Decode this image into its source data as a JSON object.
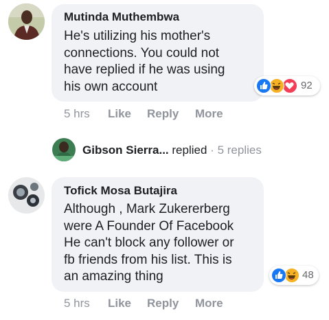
{
  "comments": [
    {
      "author": "Mutinda Muthembwa",
      "lines": [
        "He's utilizing his mother's",
        "connections. You could not",
        "have replied if he was using",
        "his own account"
      ],
      "reaction_count": "92",
      "reactions": [
        "like-icon",
        "haha-icon",
        "love-icon"
      ],
      "actions": {
        "time": "5 hrs",
        "like": "Like",
        "reply": "Reply",
        "more": "More"
      }
    },
    {
      "author": "Tofick Mosa Butajira",
      "lines": [
        "Although , Mark Zukererberg",
        "were A Founder Of Facebook",
        "He can't block any follower or",
        "fb friends from his list. This is",
        "an amazing thing"
      ],
      "reaction_count": "48",
      "reactions": [
        "like-icon",
        "haha-icon"
      ],
      "actions": {
        "time": "5 hrs",
        "like": "Like",
        "reply": "Reply",
        "more": "More"
      }
    }
  ],
  "reply_summary": {
    "name": "Gibson Sierra...",
    "verb": "replied",
    "separator": "·",
    "count": "5 replies"
  },
  "colors": {
    "like": "#1877f2",
    "love": "#f33e58",
    "haha": "#f7b125",
    "bubble": "#f0f2f5",
    "meta": "#90949c"
  }
}
